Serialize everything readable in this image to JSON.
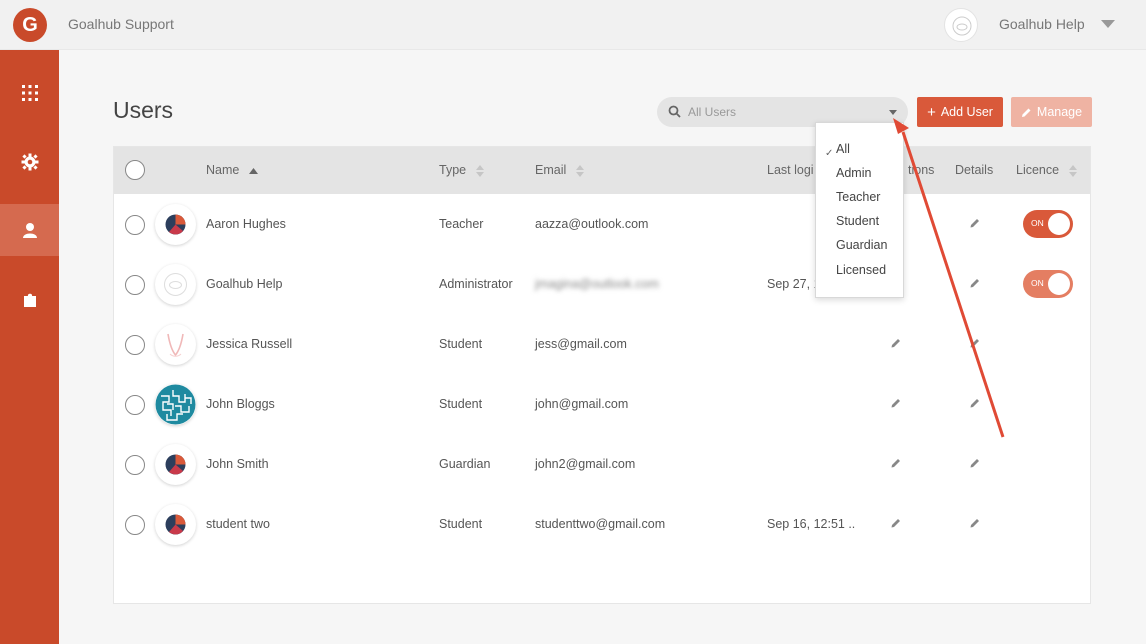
{
  "topbar": {
    "logo_letter": "G",
    "app_title": "Goalhub Support",
    "user_name": "Goalhub Help"
  },
  "sidebar": {
    "items": [
      {
        "icon": "grid-icon",
        "active": false
      },
      {
        "icon": "gear-icon",
        "active": false
      },
      {
        "icon": "user-icon",
        "active": true
      },
      {
        "icon": "puzzle-icon",
        "active": false
      }
    ]
  },
  "page": {
    "title": "Users",
    "search_placeholder": "All Users",
    "add_user_label": "Add User",
    "manage_label": "Manage"
  },
  "table": {
    "columns": [
      "Name",
      "Type",
      "Email",
      "Last logi",
      "tions",
      "Details",
      "Licence"
    ],
    "rows": [
      {
        "name": "Aaron Hughes",
        "type": "Teacher",
        "email": "aazza@outlook.com",
        "last_login": "",
        "licence": "ON"
      },
      {
        "name": "Goalhub Help",
        "type": "Administrator",
        "email": "jmagina@outlook.com",
        "last_login": "Sep 27, 1",
        "licence": "ON"
      },
      {
        "name": "Jessica Russell",
        "type": "Student",
        "email": "jess@gmail.com",
        "last_login": "",
        "licence": ""
      },
      {
        "name": "John Bloggs",
        "type": "Student",
        "email": "john@gmail.com",
        "last_login": "",
        "licence": ""
      },
      {
        "name": "John Smith",
        "type": "Guardian",
        "email": "john2@gmail.com",
        "last_login": "",
        "licence": ""
      },
      {
        "name": "student two",
        "type": "Student",
        "email": "studenttwo@gmail.com",
        "last_login": "Sep 16, 12:51 ..",
        "licence": ""
      }
    ]
  },
  "dropdown": {
    "options": [
      "All",
      "Admin",
      "Teacher",
      "Student",
      "Guardian",
      "Licensed"
    ],
    "selected": "All",
    "check_mark": "✓"
  },
  "colors": {
    "brand": "#c94a2a",
    "accent": "#d9593a",
    "annotation": "#e04a35"
  }
}
